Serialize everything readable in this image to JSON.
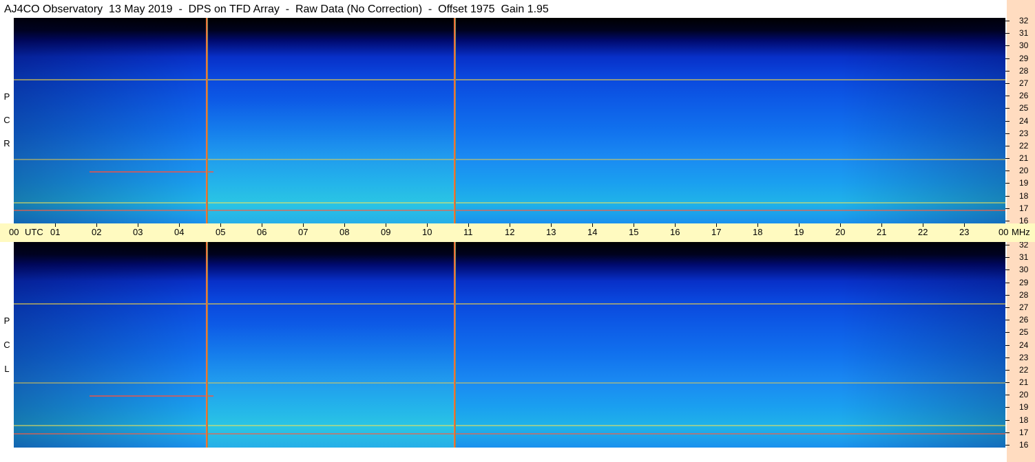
{
  "title": "AJ4CO Observatory  13 May 2019  -  DPS on TFD Array  -  Raw Data (No Correction)  -  Offset 1975  Gain 1.95",
  "panels": {
    "rcp": {
      "letters": [
        "P",
        "C",
        "R"
      ]
    },
    "lcp": {
      "letters": [
        "P",
        "C",
        "L"
      ]
    }
  },
  "freq_labels": [
    "32",
    "31",
    "30",
    "29",
    "28",
    "27",
    "26",
    "25",
    "24",
    "23",
    "22",
    "21",
    "20",
    "19",
    "18",
    "17",
    "16"
  ],
  "time_axis": {
    "start_label": "00",
    "utc_label": "UTC",
    "hours": [
      "01",
      "02",
      "03",
      "04",
      "05",
      "06",
      "07",
      "08",
      "09",
      "10",
      "11",
      "12",
      "13",
      "14",
      "15",
      "16",
      "17",
      "18",
      "19",
      "20",
      "21",
      "22",
      "23"
    ],
    "end_label": "00",
    "unit_label": "MHz"
  },
  "colors": {
    "frame": "#ffffff",
    "time_bar": "#fffac0",
    "freq_strip": "#ffdcc0",
    "spike": "#ff3040"
  }
}
